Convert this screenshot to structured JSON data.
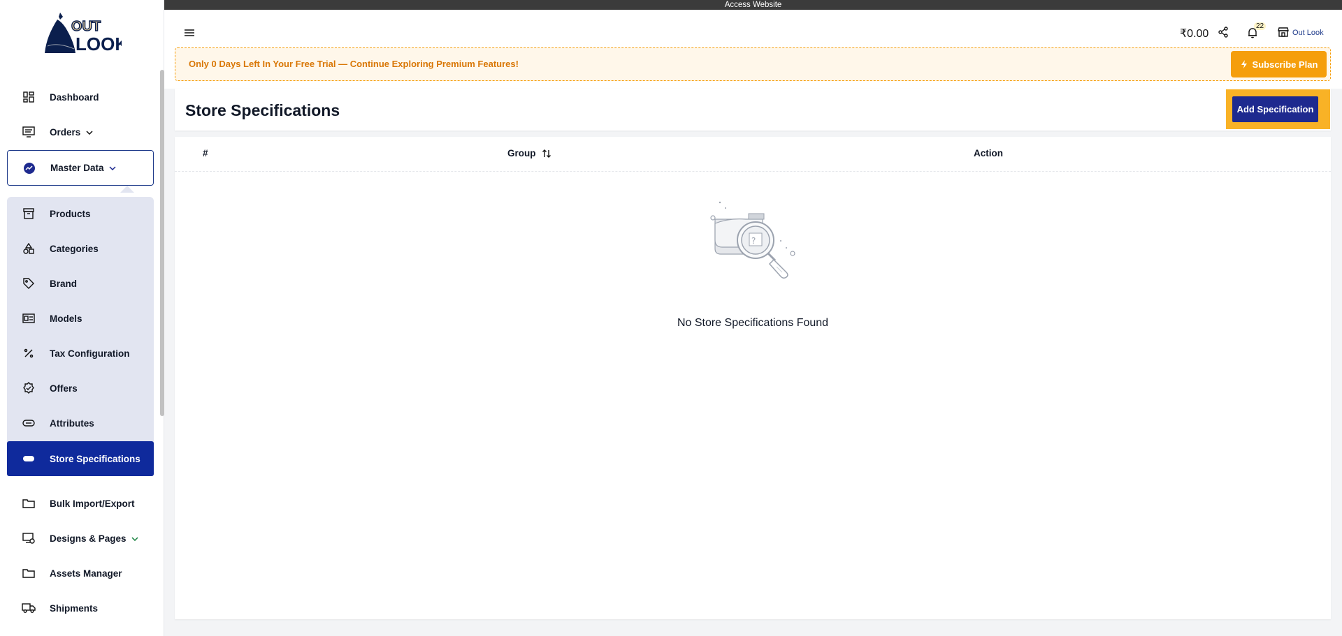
{
  "access_bar": {
    "label": "Access Website"
  },
  "brand": {
    "logo_text_top": "OUT",
    "logo_text_bottom": "LOOK"
  },
  "sidebar": {
    "items": [
      {
        "label": "Dashboard",
        "icon": "dashboard-icon"
      },
      {
        "label": "Orders",
        "icon": "orders-icon",
        "has_submenu": true
      },
      {
        "label": "Master Data",
        "icon": "chart-icon",
        "has_submenu": true,
        "expanded": true
      },
      {
        "label": "Products",
        "icon": "archive-icon"
      },
      {
        "label": "Categories",
        "icon": "shapes-icon"
      },
      {
        "label": "Brand",
        "icon": "tag-icon"
      },
      {
        "label": "Models",
        "icon": "models-icon"
      },
      {
        "label": "Tax Configuration",
        "icon": "percent-icon"
      },
      {
        "label": "Offers",
        "icon": "badge-check-icon"
      },
      {
        "label": "Attributes",
        "icon": "toggle-icon"
      },
      {
        "label": "Store Specifications",
        "icon": "toggle-icon",
        "active": true
      },
      {
        "label": "Bulk Import/Export",
        "icon": "folder-icon"
      },
      {
        "label": "Designs & Pages",
        "icon": "designs-icon",
        "has_submenu": true
      },
      {
        "label": "Assets Manager",
        "icon": "folder-icon"
      },
      {
        "label": "Shipments",
        "icon": "truck-icon"
      }
    ]
  },
  "header": {
    "wallet_balance": "₹0.00",
    "notification_count": "22",
    "store_name": "Out Look"
  },
  "trial_banner": {
    "message": "Only 0 Days Left In Your Free Trial — Continue Exploring Premium Features!",
    "button_label": "Subscribe Plan"
  },
  "page": {
    "title": "Store Specifications",
    "add_button_label": "Add Specification"
  },
  "table": {
    "columns": [
      "#",
      "Group",
      "Action"
    ],
    "rows": [],
    "empty_message": "No Store Specifications Found"
  },
  "colors": {
    "primary": "#0f2a9c",
    "accent": "#f59e0b",
    "submenu_bg": "#e2e5f1"
  }
}
